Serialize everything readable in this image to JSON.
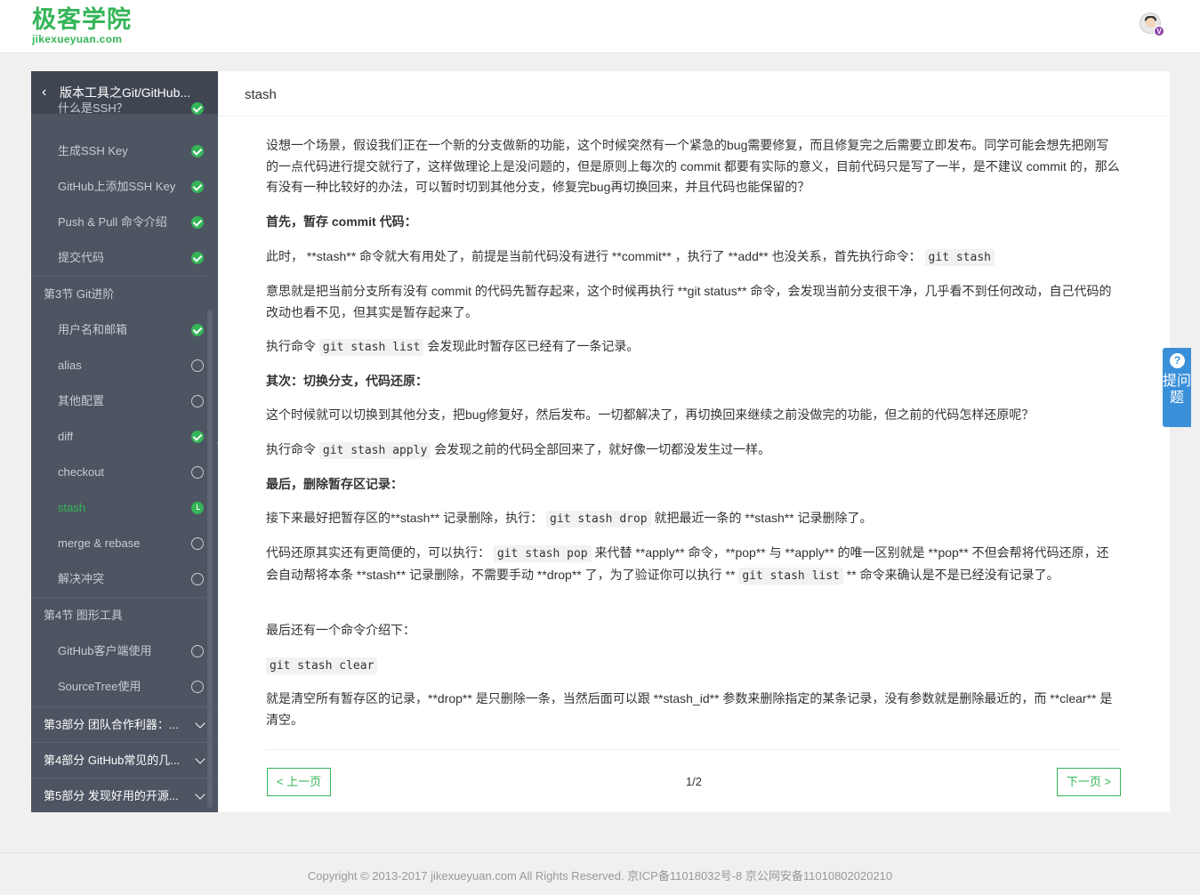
{
  "header": {
    "logo_cn": "极客学院",
    "logo_en": "jikexueyuan.com",
    "vip_badge": "V"
  },
  "sidebar": {
    "title": "版本工具之Git/GitHub...",
    "items": [
      {
        "label": "什么是SSH？",
        "status": "done"
      },
      {
        "label": "生成SSH Key",
        "status": "done"
      },
      {
        "label": "GitHub上添加SSH Key",
        "status": "done"
      },
      {
        "label": "Push & Pull 命令介绍",
        "status": "done"
      },
      {
        "label": "提交代码",
        "status": "done"
      },
      {
        "label": "第3节 Git进阶",
        "status": "section"
      },
      {
        "label": "用户名和邮箱",
        "status": "done"
      },
      {
        "label": "alias",
        "status": "todo"
      },
      {
        "label": "其他配置",
        "status": "todo"
      },
      {
        "label": "diff",
        "status": "done"
      },
      {
        "label": "checkout",
        "status": "todo"
      },
      {
        "label": "stash",
        "status": "current"
      },
      {
        "label": "merge & rebase",
        "status": "todo"
      },
      {
        "label": "解决冲突",
        "status": "todo"
      },
      {
        "label": "第4节 图形工具",
        "status": "section"
      },
      {
        "label": "GitHub客户端使用",
        "status": "todo"
      },
      {
        "label": "SourceTree使用",
        "status": "todo"
      }
    ],
    "parts": [
      "第3部分 团队合作利器：...",
      "第4部分 GitHub常见的几...",
      "第5部分 发现好用的开源..."
    ],
    "collapse_icon": "«"
  },
  "main": {
    "title": "stash",
    "p1": "设想一个场景，假设我们正在一个新的分支做新的功能，这个时候突然有一个紧急的bug需要修复，而且修复完之后需要立即发布。同学可能会想先把刚写的一点代码进行提交就行了，这样做理论上是没问题的，但是原则上每次的 commit 都要有实际的意义，目前代码只是写了一半，是不建议 commit 的，那么有没有一种比较好的办法，可以暂时切到其他分支，修复完bug再切换回来，并且代码也能保留的？",
    "h1": "首先，暂存 commit 代码：",
    "p2_a": "此时， **stash** 命令就大有用处了，前提是当前代码没有进行 **commit** ，执行了 **add** 也没关系，首先执行命令：",
    "p2_code": "git stash",
    "p3": "意思就是把当前分支所有没有 commit 的代码先暂存起来，这个时候再执行 **git status** 命令，会发现当前分支很干净，几乎看不到任何改动，自己代码的改动也看不见，但其实是暂存起来了。",
    "p4_a": "执行命令",
    "p4_code": "git stash list",
    "p4_b": "会发现此时暂存区已经有了一条记录。",
    "h2": "其次：切换分支，代码还原：",
    "p5": "这个时候就可以切换到其他分支，把bug修复好，然后发布。一切都解决了，再切换回来继续之前没做完的功能，但之前的代码怎样还原呢？",
    "p6_a": "执行命令",
    "p6_code": "git stash apply",
    "p6_b": "会发现之前的代码全部回来了，就好像一切都没发生过一样。",
    "h3": "最后，删除暂存区记录：",
    "p7_a": "接下来最好把暂存区的**stash** 记录删除，执行：",
    "p7_code": "git stash drop",
    "p7_b": "就把最近一条的 **stash** 记录删除了。",
    "p8_a": "代码还原其实还有更简便的，可以执行：",
    "p8_code1": "git stash pop",
    "p8_b": "来代替 **apply** 命令，**pop** 与 **apply** 的唯一区别就是 **pop** 不但会帮将代码还原，还会自动帮将本条 **stash** 记录删除，不需要手动 **drop** 了，为了验证你可以执行 **",
    "p8_code2": "git stash list",
    "p8_c": "** 命令来确认是不是已经没有记录了。",
    "p9": "最后还有一个命令介绍下：",
    "p10_code": "git stash clear",
    "p11": "就是清空所有暂存区的记录，**drop** 是只删除一条，当然后面可以跟 **stash_id** 参数来删除指定的某条记录，没有参数就是删除最近的，而 **clear** 是清空。",
    "prev": "< 上一页",
    "next": "下一页 >",
    "page": "1/2"
  },
  "ask": {
    "icon": "?",
    "label": "提问题"
  },
  "footer": {
    "text": "Copyright © 2013-2017 jikexueyuan.com All Rights Reserved. 京ICP备11018032号-8 京公网安备11010802020210"
  }
}
